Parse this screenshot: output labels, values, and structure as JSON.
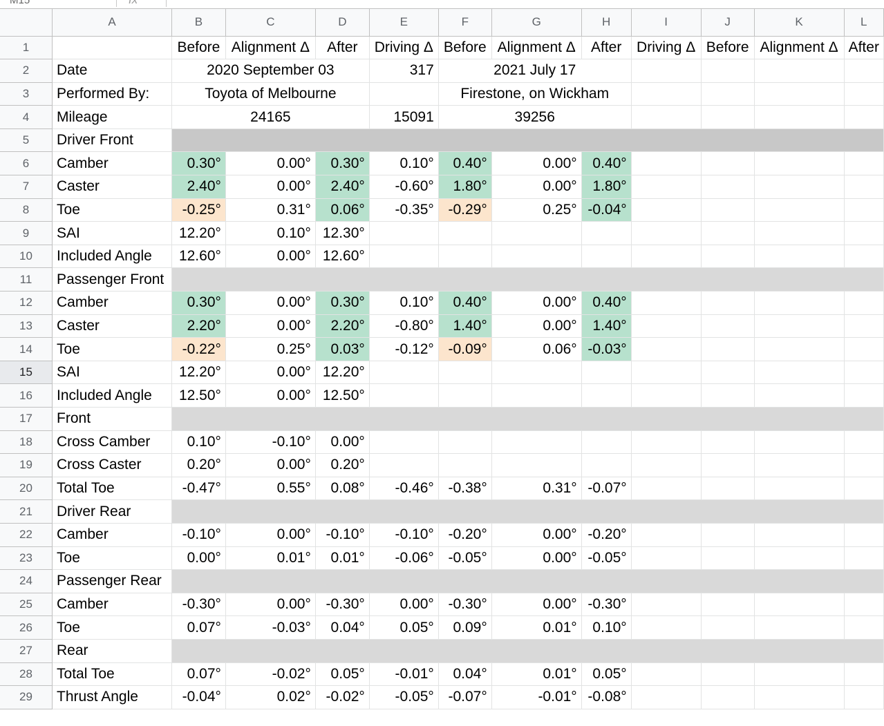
{
  "toolbar": {
    "name_box": "M15",
    "fx_symbol": "fx"
  },
  "columns": [
    "A",
    "B",
    "C",
    "D",
    "E",
    "F",
    "G",
    "H",
    "I",
    "J",
    "K",
    "L"
  ],
  "header_row": [
    "Before",
    "Alignment Δ",
    "After",
    "Driving Δ",
    "Before",
    "Alignment Δ",
    "After",
    "Driving Δ",
    "Before",
    "Alignment Δ",
    "After"
  ],
  "rows": [
    {
      "n": "2",
      "label": "Date",
      "left": "2020 September 03",
      "e": "317",
      "right": "2021 July 17"
    },
    {
      "n": "3",
      "label": "Performed By:",
      "left": "Toyota of Melbourne",
      "e": "",
      "right": "Firestone, on Wickham"
    },
    {
      "n": "4",
      "label": "Mileage",
      "left": "24165",
      "e": "15091",
      "right": "39256"
    },
    {
      "n": "5",
      "label": "Driver Front",
      "band": true,
      "dark": true
    },
    {
      "n": "6",
      "label": "Camber",
      "v": [
        "0.30°",
        "0.00°",
        "0.30°",
        "0.10°",
        "0.40°",
        "0.00°",
        "0.40°"
      ],
      "c": [
        "good",
        "",
        "good",
        "",
        "good",
        "",
        "good"
      ]
    },
    {
      "n": "7",
      "label": "Caster",
      "v": [
        "2.40°",
        "0.00°",
        "2.40°",
        "-0.60°",
        "1.80°",
        "0.00°",
        "1.80°"
      ],
      "c": [
        "good",
        "",
        "good",
        "",
        "good",
        "",
        "good"
      ]
    },
    {
      "n": "8",
      "label": "Toe",
      "v": [
        "-0.25°",
        "0.31°",
        "0.06°",
        "-0.35°",
        "-0.29°",
        "0.25°",
        "-0.04°"
      ],
      "c": [
        "warn",
        "",
        "good",
        "",
        "warn",
        "",
        "good"
      ]
    },
    {
      "n": "9",
      "label": "SAI",
      "v": [
        "12.20°",
        "0.10°",
        "12.30°",
        "",
        "",
        "",
        ""
      ]
    },
    {
      "n": "10",
      "label": "Included Angle",
      "v": [
        "12.60°",
        "0.00°",
        "12.60°",
        "",
        "",
        "",
        ""
      ]
    },
    {
      "n": "11",
      "label": "Passenger Front",
      "band": true
    },
    {
      "n": "12",
      "label": "Camber",
      "v": [
        "0.30°",
        "0.00°",
        "0.30°",
        "0.10°",
        "0.40°",
        "0.00°",
        "0.40°"
      ],
      "c": [
        "good",
        "",
        "good",
        "",
        "good",
        "",
        "good"
      ]
    },
    {
      "n": "13",
      "label": "Caster",
      "v": [
        "2.20°",
        "0.00°",
        "2.20°",
        "-0.80°",
        "1.40°",
        "0.00°",
        "1.40°"
      ],
      "c": [
        "good",
        "",
        "good",
        "",
        "good",
        "",
        "good"
      ]
    },
    {
      "n": "14",
      "label": "Toe",
      "v": [
        "-0.22°",
        "0.25°",
        "0.03°",
        "-0.12°",
        "-0.09°",
        "0.06°",
        "-0.03°"
      ],
      "c": [
        "warn",
        "",
        "good",
        "",
        "warn",
        "",
        "good"
      ]
    },
    {
      "n": "15",
      "label": "SAI",
      "v": [
        "12.20°",
        "0.00°",
        "12.20°",
        "",
        "",
        "",
        ""
      ],
      "active": true
    },
    {
      "n": "16",
      "label": "Included Angle",
      "v": [
        "12.50°",
        "0.00°",
        "12.50°",
        "",
        "",
        "",
        ""
      ]
    },
    {
      "n": "17",
      "label": "Front",
      "band": true
    },
    {
      "n": "18",
      "label": "Cross Camber",
      "v": [
        "0.10°",
        "-0.10°",
        "0.00°",
        "",
        "",
        "",
        ""
      ]
    },
    {
      "n": "19",
      "label": "Cross Caster",
      "v": [
        "0.20°",
        "0.00°",
        "0.20°",
        "",
        "",
        "",
        ""
      ]
    },
    {
      "n": "20",
      "label": "Total Toe",
      "v": [
        "-0.47°",
        "0.55°",
        "0.08°",
        "-0.46°",
        "-0.38°",
        "0.31°",
        "-0.07°"
      ]
    },
    {
      "n": "21",
      "label": "Driver Rear",
      "band": true
    },
    {
      "n": "22",
      "label": "Camber",
      "v": [
        "-0.10°",
        "0.00°",
        "-0.10°",
        "-0.10°",
        "-0.20°",
        "0.00°",
        "-0.20°"
      ]
    },
    {
      "n": "23",
      "label": "Toe",
      "v": [
        "0.00°",
        "0.01°",
        "0.01°",
        "-0.06°",
        "-0.05°",
        "0.00°",
        "-0.05°"
      ]
    },
    {
      "n": "24",
      "label": "Passenger Rear",
      "band": true
    },
    {
      "n": "25",
      "label": "Camber",
      "v": [
        "-0.30°",
        "0.00°",
        "-0.30°",
        "0.00°",
        "-0.30°",
        "0.00°",
        "-0.30°"
      ]
    },
    {
      "n": "26",
      "label": "Toe",
      "v": [
        "0.07°",
        "-0.03°",
        "0.04°",
        "0.05°",
        "0.09°",
        "0.01°",
        "0.10°"
      ]
    },
    {
      "n": "27",
      "label": "Rear",
      "band": true
    },
    {
      "n": "28",
      "label": "Total Toe",
      "v": [
        "0.07°",
        "-0.02°",
        "0.05°",
        "-0.01°",
        "0.04°",
        "0.01°",
        "0.05°"
      ]
    },
    {
      "n": "29",
      "label": "Thrust Angle",
      "v": [
        "-0.04°",
        "0.02°",
        "-0.02°",
        "-0.05°",
        "-0.07°",
        "-0.01°",
        "-0.08°"
      ]
    }
  ],
  "colors": {
    "good": "#b7e1cd",
    "warn": "#fce5cd",
    "band": "#d9d9d9",
    "header_bg": "#f8f9fa",
    "selection": "#a8c7fa"
  }
}
